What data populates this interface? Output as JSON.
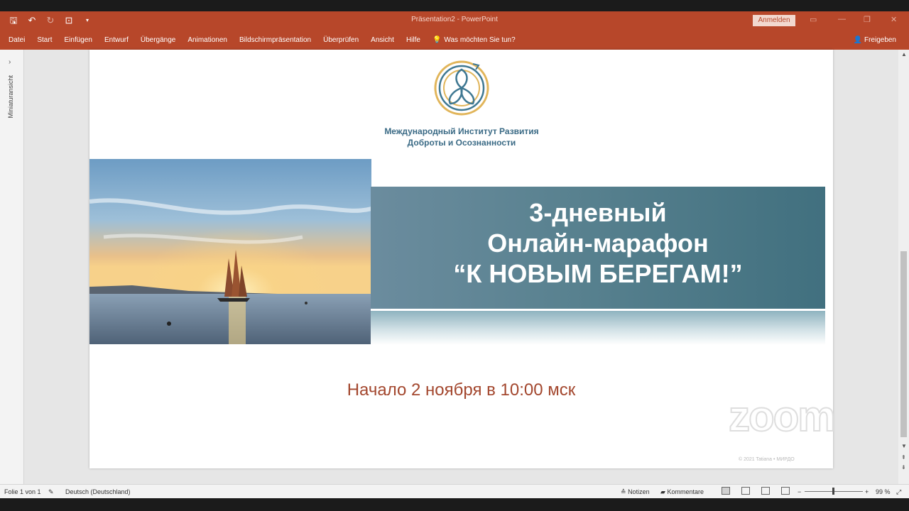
{
  "app": {
    "document_title": "Präsentation2  -  PowerPoint",
    "signin_label": "Anmelden",
    "share_label": "Freigeben"
  },
  "ribbon": {
    "tabs": [
      "Datei",
      "Start",
      "Einfügen",
      "Entwurf",
      "Übergänge",
      "Animationen",
      "Bildschirmpräsentation",
      "Überprüfen",
      "Ansicht",
      "Hilfe"
    ],
    "tell_me": "Was möchten Sie tun?"
  },
  "thumbnail_pane": {
    "label": "Miniaturansicht"
  },
  "slide": {
    "org_name_line1": "Международный Институт Развития",
    "org_name_line2": "Доброты и Осознанности",
    "title_line1": "3-дневный",
    "title_line2": "Онлайн-марафон",
    "title_line3": "“К НОВЫМ БЕРЕГАМ!”",
    "start_text": "Начало 2 ноября в 10:00 мск",
    "watermark": "© 2021 Tatiana • МИРДО"
  },
  "overlay": {
    "zoom_logo": "zoom"
  },
  "statusbar": {
    "slide_counter": "Folie 1 von 1",
    "language": "Deutsch (Deutschland)",
    "notes_label": "Notizen",
    "comments_label": "Kommentare",
    "zoom_minus": "−",
    "zoom_plus": "+",
    "zoom_level": "99 %"
  },
  "colors": {
    "accent": "#b7472a",
    "banner": "#4f7b8b",
    "start_text": "#a3472e",
    "org_text": "#3a6a85"
  }
}
